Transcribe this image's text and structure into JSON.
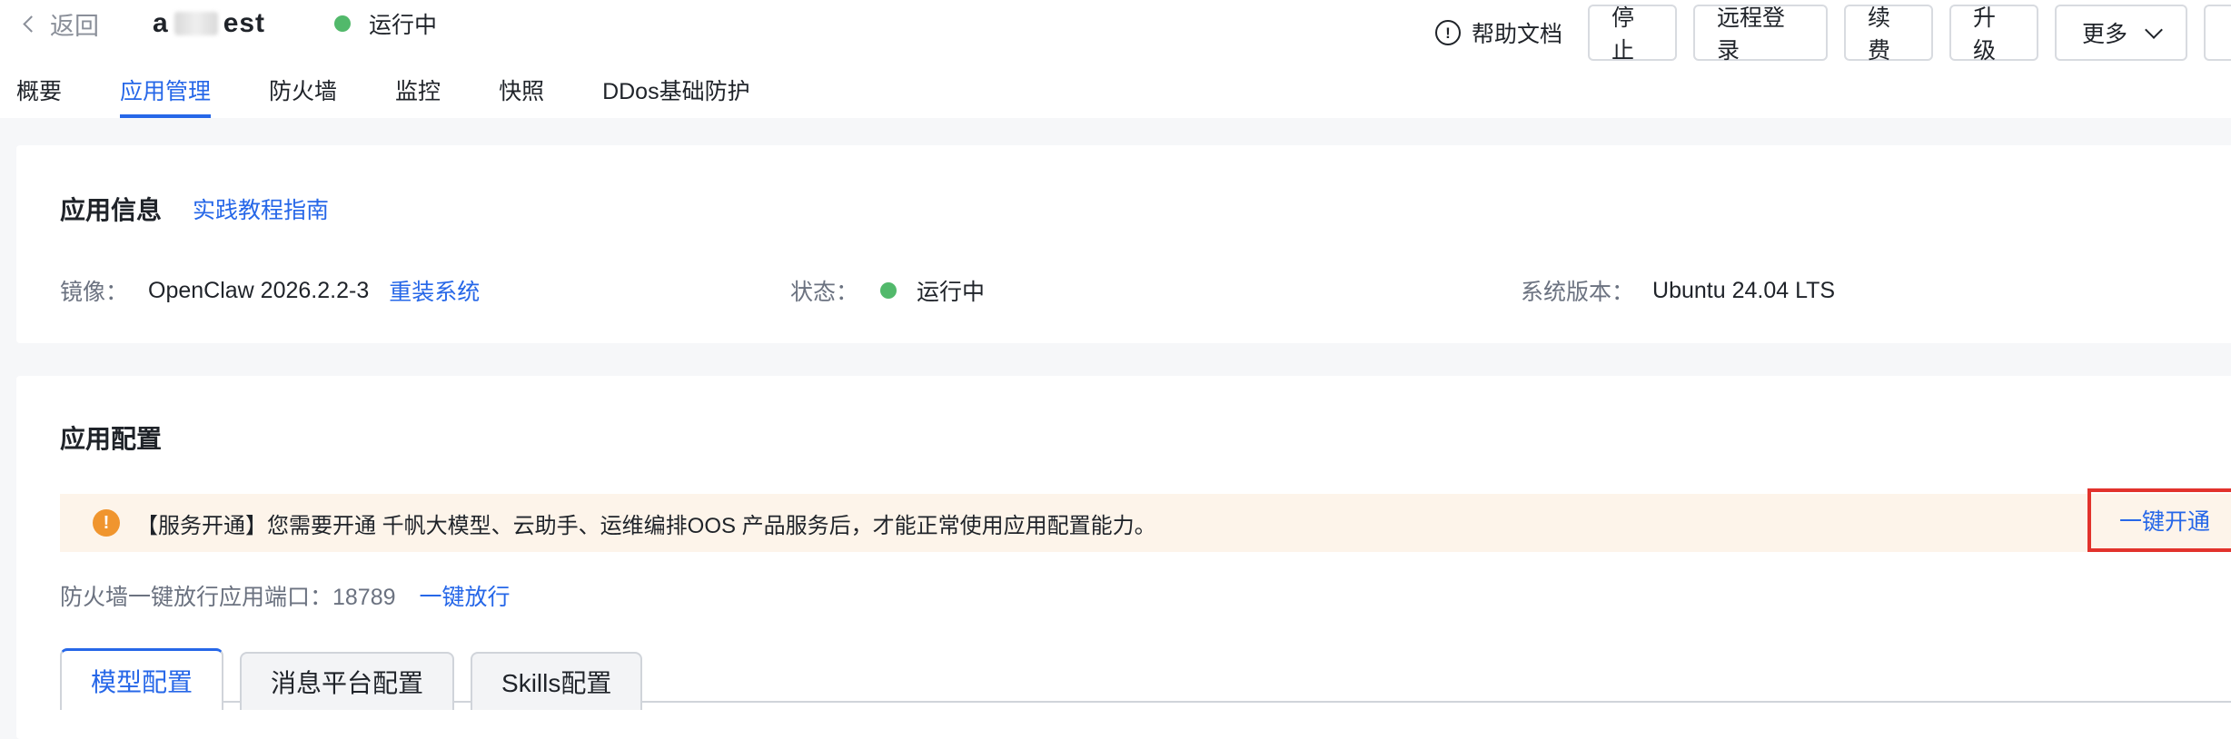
{
  "header": {
    "back_label": "返回",
    "instance_name_start": "a",
    "instance_name_end": "est",
    "status": "运行中",
    "help_label": "帮助文档",
    "buttons": {
      "stop": "停止",
      "remote_login": "远程登录",
      "renew": "续费",
      "upgrade": "升级",
      "more": "更多"
    },
    "tabs": [
      "概要",
      "应用管理",
      "防火墙",
      "监控",
      "快照",
      "DDos基础防护"
    ],
    "active_tab": "应用管理"
  },
  "app_info": {
    "title": "应用信息",
    "guide_link": "实践教程指南",
    "image_label": "镜像：",
    "image_value": "OpenClaw 2026.2.2-3",
    "reinstall_link": "重装系统",
    "status_label": "状态：",
    "status_value": "运行中",
    "os_label": "系统版本：",
    "os_value": "Ubuntu 24.04 LTS"
  },
  "app_config": {
    "title": "应用配置",
    "banner_text": "【服务开通】您需要开通 千帆大模型、云助手、运维编排OOS 产品服务后，才能正常使用应用配置能力。",
    "enable_link": "一键开通",
    "firewall_text": "防火墙一键放行应用端口：18789",
    "firewall_link": "一键放行",
    "subtabs": [
      "模型配置",
      "消息平台配置",
      "Skills配置"
    ]
  },
  "colors": {
    "accent": "#2667e8",
    "running": "#52b96b",
    "warning": "#f0952e",
    "highlight": "#e2322c"
  }
}
